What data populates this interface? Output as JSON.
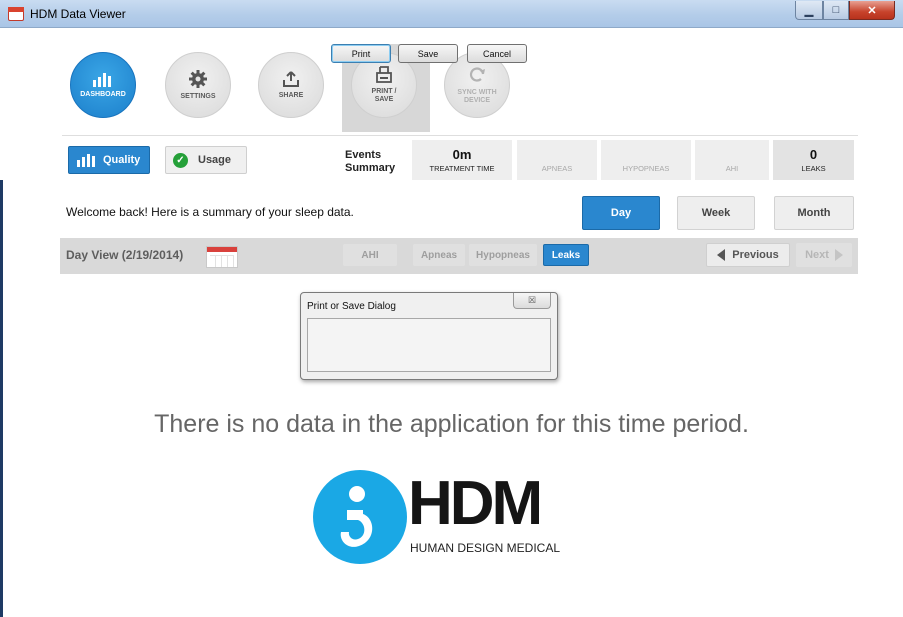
{
  "window": {
    "title": "HDM Data Viewer",
    "controls": [
      "minimize",
      "maximize",
      "close"
    ]
  },
  "nav": {
    "dashboard": "DASHBOARD",
    "settings": "SETTINGS",
    "share": "SHARE",
    "print_save_line1": "PRINT /",
    "print_save_line2": "SAVE",
    "sync_line1": "SYNC WITH",
    "sync_line2": "DEVICE"
  },
  "view_toggle": {
    "quality": "Quality",
    "usage": "Usage"
  },
  "summary": {
    "label_line1": "Events",
    "label_line2": "Summary",
    "treatment_time_value": "0m",
    "treatment_time_label": "TREATMENT TIME",
    "apneas_label": "APNEAS",
    "hypopneas_label": "HYPOPNEAS",
    "ahi_label": "AHI",
    "leaks_value": "0",
    "leaks_label": "LEAKS"
  },
  "welcome": "Welcome back! Here is a summary of your sleep data.",
  "range": {
    "day": "Day",
    "week": "Week",
    "month": "Month",
    "selected": "Day"
  },
  "day_view": {
    "title": "Day View (2/19/2014)",
    "tabs": [
      "AHI",
      "Apneas",
      "Hypopneas",
      "Leaks"
    ],
    "active_tab": "Leaks",
    "previous": "Previous",
    "next": "Next"
  },
  "dialog": {
    "title": "Print or Save Dialog",
    "close_glyph": "☒",
    "print": "Print",
    "save": "Save",
    "cancel": "Cancel"
  },
  "no_data_message": "There is no data in the application for this time period.",
  "logo": {
    "wordmark": "HDM",
    "subtitle": "HUMAN DESIGN MEDICAL"
  },
  "colors": {
    "accent_blue": "#2a87cf",
    "logo_blue": "#1aa8e5",
    "check_green": "#25a039"
  }
}
